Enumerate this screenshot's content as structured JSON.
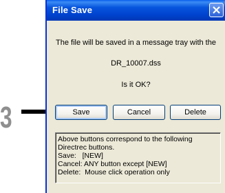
{
  "step": {
    "number": "3"
  },
  "window": {
    "title": "File Save",
    "close_icon": "close-x-icon"
  },
  "message": {
    "line1": "The file will be saved in a message tray with the",
    "filename": "DR_10007.dss",
    "question": "Is it OK?"
  },
  "buttons": {
    "save": "Save",
    "cancel": "Cancel",
    "delete": "Delete"
  },
  "info": {
    "lines": [
      "Above buttons correspond to the following",
      "Directrec buttons.",
      "Save:   [NEW]",
      "Cancel: ANY button except [NEW]",
      "Delete:  Mouse click operation only"
    ]
  },
  "colors": {
    "title_bar": "#0043cf",
    "window_bg": "#ece9d8",
    "step_number": "#8f8f8f"
  }
}
